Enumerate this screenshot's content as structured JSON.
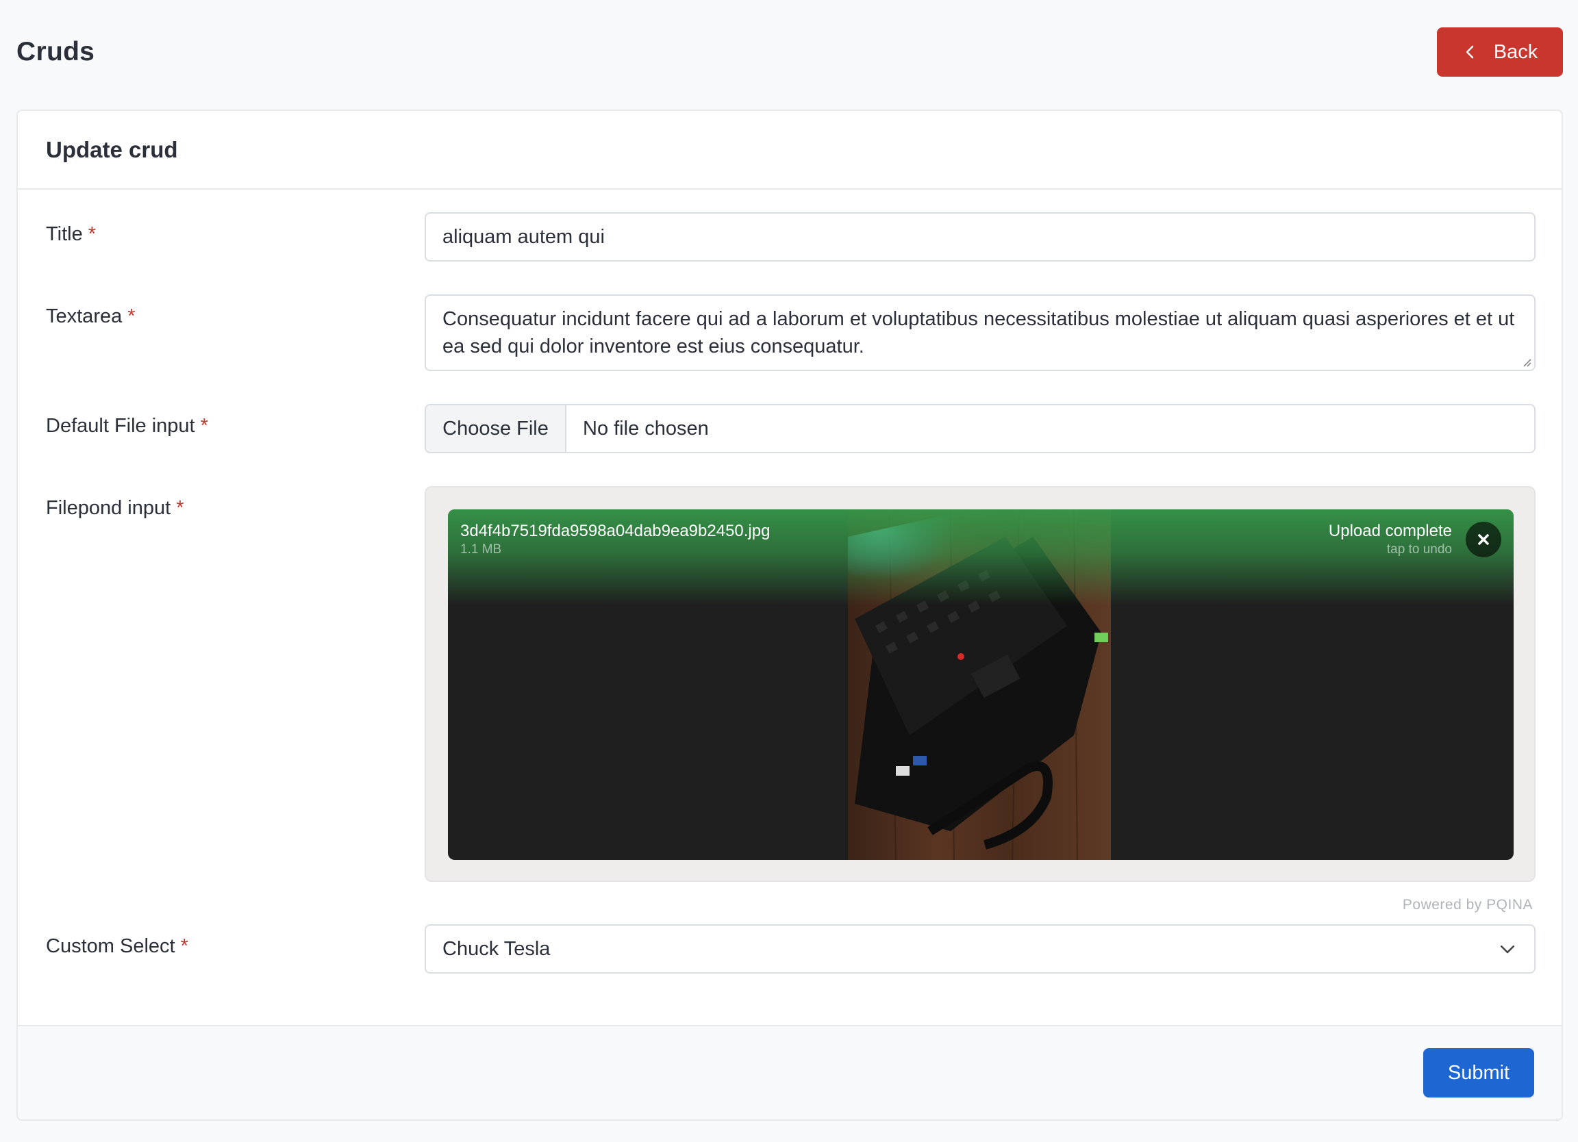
{
  "page": {
    "title": "Cruds",
    "back_label": "Back"
  },
  "card": {
    "title": "Update crud"
  },
  "form": {
    "title": {
      "label": "Title",
      "required_mark": "*",
      "value": "aliquam autem qui"
    },
    "textarea": {
      "label": "Textarea",
      "required_mark": "*",
      "value": "Consequatur incidunt facere qui ad a laborum et voluptatibus necessitatibus molestiae ut aliquam quasi asperiores et et ut ea sed qui dolor inventore est eius consequatur."
    },
    "default_file": {
      "label": "Default File input",
      "required_mark": "*",
      "button_label": "Choose File",
      "status": "No file chosen"
    },
    "filepond": {
      "label": "Filepond input",
      "required_mark": "*",
      "file_name": "3d4f4b7519fda9598a04dab9ea9b2450.jpg",
      "file_size": "1.1 MB",
      "status": "Upload complete",
      "sub_status": "tap to undo",
      "credits": "Powered by PQINA"
    },
    "custom_select": {
      "label": "Custom Select",
      "required_mark": "*",
      "value": "Chuck Tesla"
    }
  },
  "footer": {
    "submit_label": "Submit"
  },
  "colors": {
    "danger": "#c9362d",
    "primary": "#1e66d2",
    "upload_success": "#369a4a"
  },
  "icons": [
    "chevron-left-icon",
    "close-icon",
    "chevron-down-icon",
    "resize-grip-icon"
  ]
}
